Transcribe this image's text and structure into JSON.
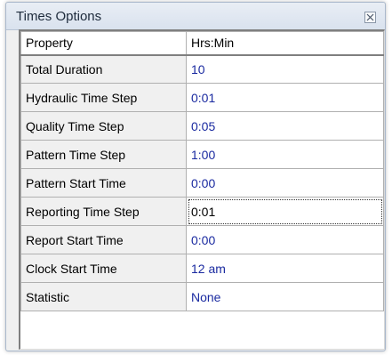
{
  "window": {
    "title": "Times Options"
  },
  "grid": {
    "header": {
      "property": "Property",
      "value": "Hrs:Min"
    },
    "rows": [
      {
        "label": "Total Duration",
        "value": "10"
      },
      {
        "label": "Hydraulic Time Step",
        "value": "0:01"
      },
      {
        "label": "Quality Time Step",
        "value": "0:05"
      },
      {
        "label": "Pattern Time Step",
        "value": "1:00"
      },
      {
        "label": "Pattern Start Time",
        "value": "0:00"
      },
      {
        "label": "Reporting Time Step",
        "value": "0:01"
      },
      {
        "label": "Report Start Time",
        "value": "0:00"
      },
      {
        "label": "Clock Start Time",
        "value": "12 am"
      },
      {
        "label": "Statistic",
        "value": "None"
      }
    ]
  },
  "colors": {
    "value_text": "#1a2aa0",
    "property_background": "#f0f0f0",
    "titlebar": "#dfe6ef"
  }
}
